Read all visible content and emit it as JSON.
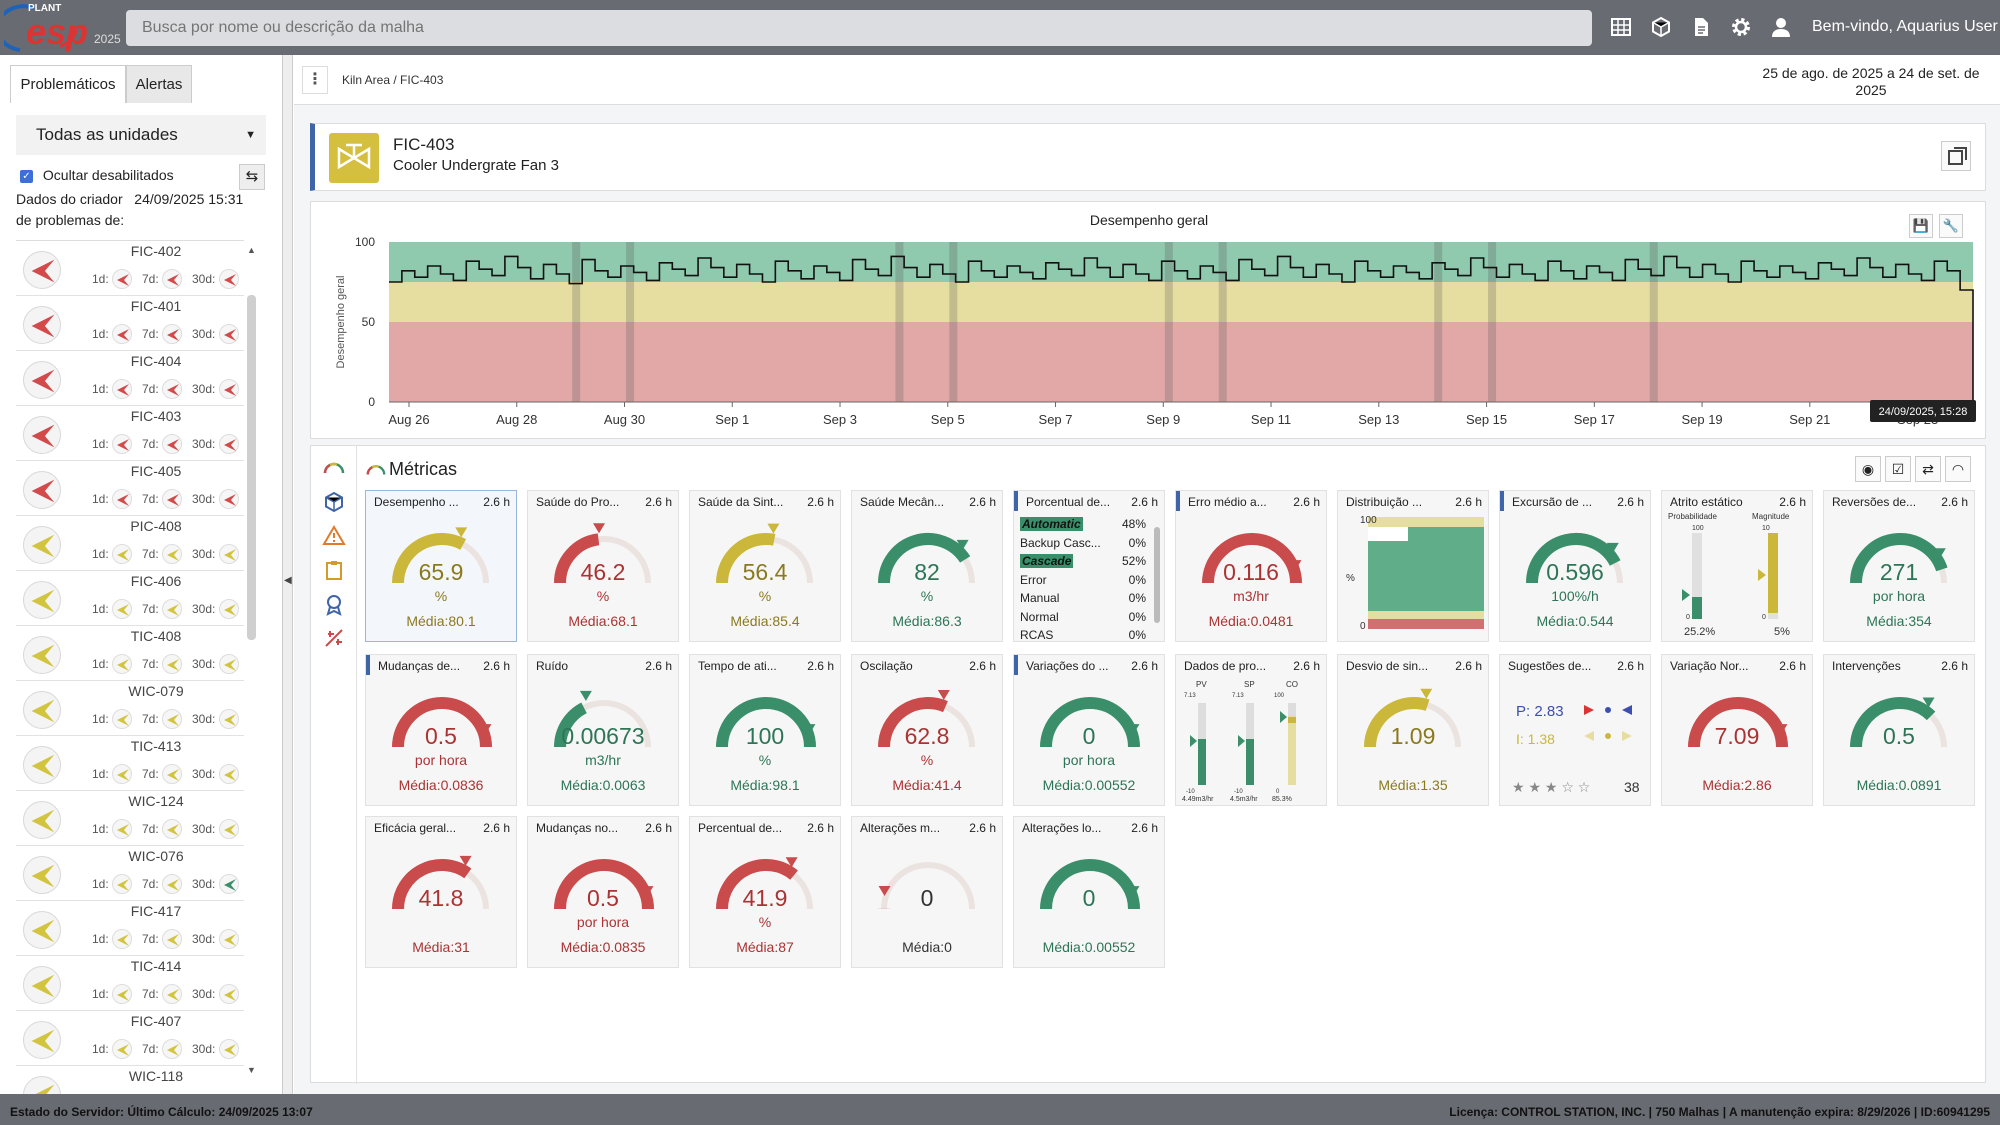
{
  "app": {
    "logo_top": "PLANT",
    "logo_main": "esp",
    "logo_year": "2025",
    "search_placeholder": "Busca por nome ou descrição da malha",
    "welcome": "Bem-vindo, Aquarius User"
  },
  "sidebar": {
    "tabs": [
      "Problemáticos",
      "Alertas"
    ],
    "unit_select": "Todas as unidades",
    "hide_disabled": "Ocultar desabilitados",
    "creator_line1": "Dados do criador   24/09/2025 15:31",
    "creator_line2": "de problemas de:",
    "lbl_1d": "1d:",
    "lbl_7d": "7d:",
    "lbl_30d": "30d:",
    "items": [
      {
        "name": "FIC-402",
        "color": "#d34a4a"
      },
      {
        "name": "FIC-401",
        "color": "#d34a4a"
      },
      {
        "name": "FIC-404",
        "color": "#d34a4a"
      },
      {
        "name": "FIC-403",
        "color": "#d34a4a"
      },
      {
        "name": "FIC-405",
        "color": "#d34a4a"
      },
      {
        "name": "PIC-408",
        "color": "#d3c43f"
      },
      {
        "name": "FIC-406",
        "color": "#d3c43f"
      },
      {
        "name": "TIC-408",
        "color": "#d3c43f"
      },
      {
        "name": "WIC-079",
        "color": "#d3c43f"
      },
      {
        "name": "TIC-413",
        "color": "#d3c43f"
      },
      {
        "name": "WIC-124",
        "color": "#d3c43f"
      },
      {
        "name": "WIC-076",
        "color": "#d3c43f"
      },
      {
        "name": "FIC-417",
        "color": "#d3c43f"
      },
      {
        "name": "TIC-414",
        "color": "#d3c43f"
      },
      {
        "name": "FIC-407",
        "color": "#d3c43f"
      },
      {
        "name": "WIC-118",
        "color": "#d3c43f"
      }
    ]
  },
  "main": {
    "breadcrumb_root": "Kiln Area",
    "breadcrumb_sep": " / ",
    "breadcrumb_current": "FIC-403",
    "date_range": "25 de ago. de 2025 a 24 de set. de 2025",
    "loop_name": "FIC-403",
    "loop_desc": "Cooler Undergrate Fan 3",
    "metrics_title": "Métricas"
  },
  "chart_data": {
    "type": "line",
    "title": "Desempenho geral",
    "ylabel": "Desempenho geral",
    "ylim": [
      0,
      100
    ],
    "y_ticks": [
      "100",
      "50",
      "0"
    ],
    "x_ticks": [
      "Aug 26",
      "Aug 28",
      "Aug 30",
      "Sep 1",
      "Sep 3",
      "Sep 5",
      "Sep 7",
      "Sep 9",
      "Sep 11",
      "Sep 13",
      "Sep 15",
      "Sep 17",
      "Sep 19",
      "Sep 21",
      "Sep 23"
    ],
    "bands": [
      {
        "from": 0,
        "to": 50,
        "color": "#e2a8a8"
      },
      {
        "from": 50,
        "to": 75,
        "color": "#e6dea0"
      },
      {
        "from": 75,
        "to": 100,
        "color": "#8fc9ae"
      }
    ],
    "tooltip": "24/09/2025, 15:28",
    "series": [
      {
        "values": [
          75,
          82,
          78,
          85,
          80,
          76,
          88,
          83,
          79,
          91,
          84,
          77,
          86,
          80,
          74,
          89,
          82,
          78,
          85,
          81,
          76,
          87,
          83,
          79,
          90,
          84,
          78,
          86,
          80,
          75,
          88,
          82,
          77,
          85,
          81,
          76,
          89,
          83,
          79,
          91,
          84,
          78,
          86,
          80,
          75,
          88,
          82,
          78,
          85,
          81,
          77,
          87,
          83,
          79,
          90,
          84,
          78,
          86,
          80,
          76,
          88,
          82,
          77,
          85,
          81,
          76,
          89,
          83,
          79,
          91,
          84,
          78,
          86,
          80,
          75,
          88,
          82,
          78,
          85,
          81,
          77,
          87,
          83,
          79,
          90,
          84,
          78,
          86,
          80,
          76,
          88,
          82,
          77,
          85,
          81,
          76,
          89,
          83,
          79,
          91,
          84,
          78,
          86,
          80,
          75,
          88,
          82,
          78,
          85,
          81,
          77,
          87,
          83,
          79,
          90,
          84,
          78,
          86,
          80,
          76,
          88,
          82,
          70
        ]
      }
    ]
  },
  "metrics": [
    {
      "id": "desempenho",
      "name": "Desempenho ...",
      "hours": "2.6 h",
      "value": "65.9",
      "unit": "%",
      "media": "Média:80.1",
      "pct": 0.66,
      "color": "#cbb73a",
      "valColor": "#8a7a1d"
    },
    {
      "id": "saude-processo",
      "name": "Saúde do Pro...",
      "hours": "2.6 h",
      "value": "46.2",
      "unit": "%",
      "media": "Média:68.1",
      "pct": 0.46,
      "color": "#c94b4b",
      "valColor": "#a33"
    },
    {
      "id": "saude-sintonia",
      "name": "Saúde da Sint...",
      "hours": "2.6 h",
      "value": "56.4",
      "unit": "%",
      "media": "Média:85.4",
      "pct": 0.56,
      "color": "#cbb73a",
      "valColor": "#8a7a1d"
    },
    {
      "id": "saude-mecanica",
      "name": "Saúde Mecân...",
      "hours": "2.6 h",
      "value": "82",
      "unit": "%",
      "media": "Média:86.3",
      "pct": 0.82,
      "color": "#3a8f6a",
      "valColor": "#2d7556"
    },
    {
      "id": "porcentual-modo",
      "name": "Porcentual de...",
      "hours": "2.6 h",
      "modes": [
        {
          "label": "Automatic",
          "pct": "48%"
        },
        {
          "label": "Backup Casc...",
          "pct": "0%"
        },
        {
          "label": "Cascade",
          "pct": "52%"
        },
        {
          "label": "Error",
          "pct": "0%"
        },
        {
          "label": "Manual",
          "pct": "0%"
        },
        {
          "label": "Normal",
          "pct": "0%"
        },
        {
          "label": "RCAS",
          "pct": "0%"
        }
      ]
    },
    {
      "id": "erro-medio",
      "name": "Erro médio a...",
      "hours": "2.6 h",
      "value": "0.116",
      "unit": "m3/hr",
      "media": "Média:0.0481",
      "pct": 1.0,
      "color": "#c94b4b",
      "valColor": "#a33"
    },
    {
      "id": "distribuicao",
      "name": "Distribuição ...",
      "hours": "2.6 h",
      "ymax": "100",
      "ymin": "0",
      "yl": "%"
    },
    {
      "id": "excursao",
      "name": "Excursão de ...",
      "hours": "2.6 h",
      "value": "0.596",
      "unit": "100%/h",
      "media": "Média:0.544",
      "pct": 0.85,
      "color": "#3a8f6a",
      "valColor": "#2d7556"
    },
    {
      "id": "atrito",
      "name": "Atrito estático",
      "hours": "2.6 h",
      "prob_label": "Probabilidade",
      "mag_label": "Magnitude",
      "prob": "25.2%",
      "mag": "5%",
      "p100": "100",
      "p0": "0",
      "m10": "10",
      "m0": "0"
    },
    {
      "id": "reversoes",
      "name": "Reversões de...",
      "hours": "2.6 h",
      "value": "271",
      "unit": "por hora",
      "media": "Média:354",
      "pct": 0.9,
      "color": "#3a8f6a",
      "valColor": "#2d7556"
    },
    {
      "id": "mudancas-direcao",
      "name": "Mudanças de...",
      "hours": "2.6 h",
      "value": "0.5",
      "unit": "por hora",
      "media": "Média:0.0836",
      "pct": 1.0,
      "color": "#c94b4b",
      "valColor": "#a33"
    },
    {
      "id": "ruido",
      "name": "Ruído",
      "hours": "2.6 h",
      "value": "0.00673",
      "unit": "m3/hr",
      "media": "Média:0.0063",
      "pct": 0.35,
      "color": "#3a8f6a",
      "valColor": "#2d7556"
    },
    {
      "id": "tempo-atividade",
      "name": "Tempo de ati...",
      "hours": "2.6 h",
      "value": "100",
      "unit": "%",
      "media": "Média:98.1",
      "pct": 1.0,
      "color": "#3a8f6a",
      "valColor": "#2d7556"
    },
    {
      "id": "oscilacao",
      "name": "Oscilação",
      "hours": "2.6 h",
      "value": "62.8",
      "unit": "%",
      "media": "Média:41.4",
      "pct": 0.63,
      "color": "#c94b4b",
      "valColor": "#a33"
    },
    {
      "id": "variacoes",
      "name": "Variações do ...",
      "hours": "2.6 h",
      "value": "0",
      "unit": "por hora",
      "media": "Média:0.00552",
      "pct": 1.0,
      "color": "#3a8f6a",
      "valColor": "#2d7556"
    },
    {
      "id": "dados-processo",
      "name": "Dados de pro...",
      "hours": "2.6 h",
      "pv": "PV",
      "sp": "SP",
      "co": "CO",
      "pv_top": "7.13",
      "sp_top": "7.13",
      "co_top": "100",
      "pv_bot": "-10",
      "sp_bot": "-10",
      "co_bot": "0",
      "pv_val": "4.49m3/hr",
      "sp_val": "4.5m3/hr",
      "co_val": "85.3%"
    },
    {
      "id": "desvio-sintonia",
      "name": "Desvio de sin...",
      "hours": "2.6 h",
      "value": "1.09",
      "unit": "",
      "media": "Média:1.35",
      "pct": 0.6,
      "color": "#cbb73a",
      "valColor": "#8a7a1d"
    },
    {
      "id": "sugestoes",
      "name": "Sugestões de...",
      "hours": "2.6 h",
      "p": "P: 2.83",
      "i": "I: 1.38",
      "rating_count": "38",
      "stars": "★ ★ ★ ☆ ☆"
    },
    {
      "id": "variacao-normalizada",
      "name": "Variação Nor...",
      "hours": "2.6 h",
      "value": "7.09",
      "unit": "",
      "media": "Média:2.86",
      "pct": 1.0,
      "color": "#c94b4b",
      "valColor": "#a33"
    },
    {
      "id": "intervencoes",
      "name": "Intervenções",
      "hours": "2.6 h",
      "value": "0.5",
      "unit": "",
      "media": "Média:0.0891",
      "pct": 0.75,
      "color": "#3a8f6a",
      "valColor": "#2d7556"
    },
    {
      "id": "eficacia",
      "name": "Eficácia geral...",
      "hours": "2.6 h",
      "value": "41.8",
      "unit": "",
      "media": "Média:31",
      "pct": 0.7,
      "color": "#c94b4b",
      "valColor": "#a33"
    },
    {
      "id": "mudancas-modo",
      "name": "Mudanças no...",
      "hours": "2.6 h",
      "value": "0.5",
      "unit": "por hora",
      "media": "Média:0.0835",
      "pct": 1.0,
      "color": "#c94b4b",
      "valColor": "#a33"
    },
    {
      "id": "percentual-sat",
      "name": "Percentual de...",
      "hours": "2.6 h",
      "value": "41.9",
      "unit": "%",
      "media": "Média:87",
      "pct": 0.72,
      "color": "#c94b4b",
      "valColor": "#a33"
    },
    {
      "id": "alteracoes-m",
      "name": "Alterações m...",
      "hours": "2.6 h",
      "value": "0",
      "unit": "",
      "media": "Média:0",
      "pct": 0.0,
      "color": "#c94b4b",
      "valColor": "#333"
    },
    {
      "id": "alteracoes-lo",
      "name": "Alterações lo...",
      "hours": "2.6 h",
      "value": "0",
      "unit": "",
      "media": "Média:0.00552",
      "pct": 1.0,
      "color": "#3a8f6a",
      "valColor": "#2d7556"
    }
  ],
  "status": {
    "left": "Estado do Servidor: Último Cálculo: 24/09/2025 13:07",
    "right": "Licença: CONTROL STATION, INC. | 750 Malhas | A manutenção expira: 8/29/2026 | ID:60941295"
  }
}
